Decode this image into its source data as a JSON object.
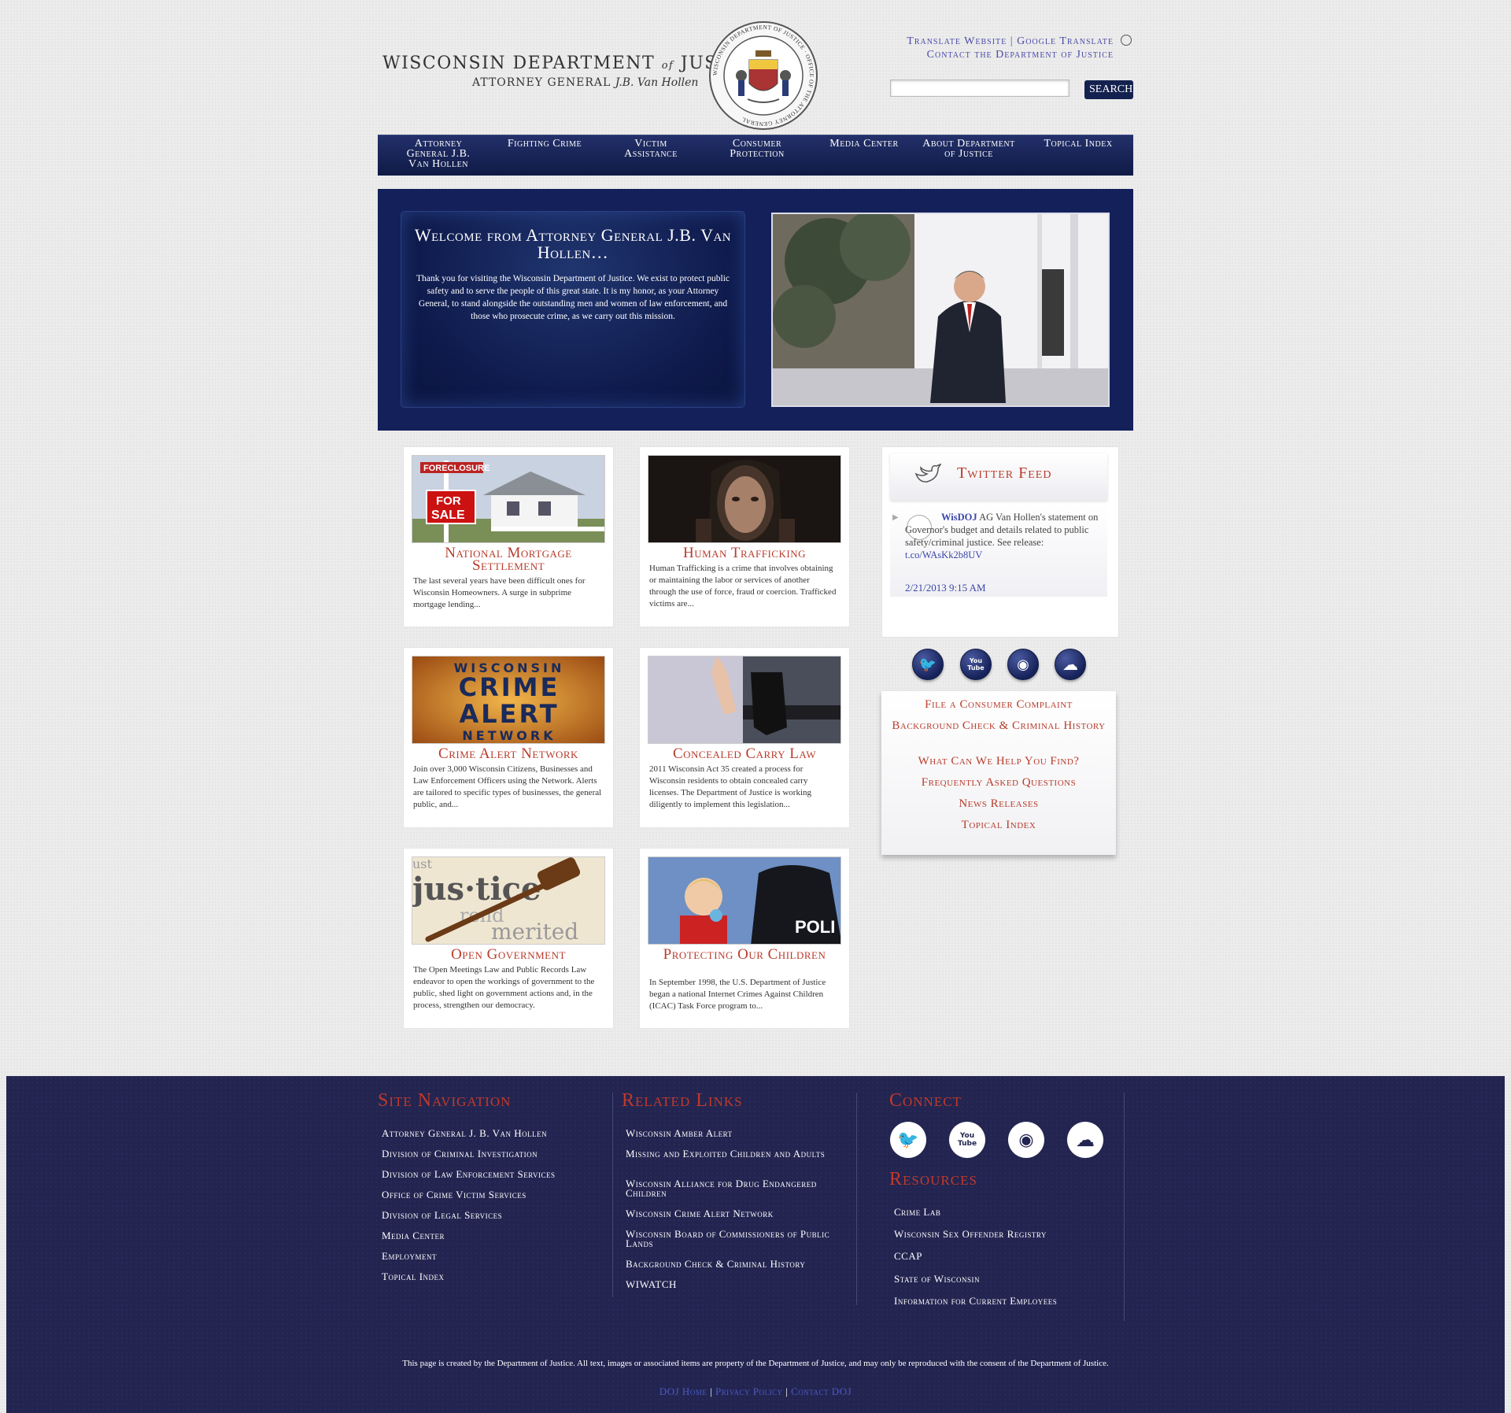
{
  "header": {
    "title_part1": "WISCONSIN DEPARTMENT",
    "title_of": "of",
    "title_part2": "JUSTICE",
    "subtitle_prefix": "ATTORNEY GENERAL",
    "subtitle_name": "J.B. Van Hollen",
    "seal_text": "WISCONSIN DEPARTMENT OF JUSTICE · OFFICE OF THE ATTORNEY GENERAL",
    "translate_website": "Translate Website",
    "link_separator": "|",
    "google_translate": "Google Translate",
    "contact": "Contact the Department of Justice",
    "search_placeholder": "",
    "search_button": "SEARCH"
  },
  "nav": [
    {
      "label": "Attorney General J.B. Van Hollen"
    },
    {
      "label": "Fighting Crime"
    },
    {
      "label": "Victim Assistance"
    },
    {
      "label": "Consumer Protection"
    },
    {
      "label": "Media Center"
    },
    {
      "label": "About Department of Justice"
    },
    {
      "label": "Topical Index"
    }
  ],
  "hero": {
    "title": "Welcome from Attorney General J.B. Van Hollen…",
    "text": "Thank you for visiting the Wisconsin Department of Justice. We exist to protect public safety and to serve the people of this great state. It is my honor, as your Attorney General, to stand alongside the outstanding men and women of law enforcement, and those who prosecute crime, as we carry out this mission."
  },
  "cards": [
    {
      "title": "National Mortgage Settlement",
      "text": "The last several years have been difficult ones for Wisconsin Homeowners. A surge in subprime mortgage lending...",
      "img_sign1": "FORECLOSURE",
      "img_sign2": "FOR",
      "img_sign3": "SALE"
    },
    {
      "title": "Human Trafficking",
      "text": "Human Trafficking is a crime that involves obtaining or maintaining the labor or services of another through the use of force, fraud or coercion. Trafficked victims are..."
    },
    {
      "title": "Crime Alert Network",
      "text": "Join over 3,000 Wisconsin Citizens, Businesses and Law Enforcement Officers using the Network. Alerts are tailored to specific types of businesses, the general public, and...",
      "img_line1": "WISCONSIN",
      "img_line2": "CRIME",
      "img_line3": "ALERT",
      "img_line4": "NETWORK"
    },
    {
      "title": "Concealed Carry Law",
      "text": "2011 Wisconsin Act 35 created a process for Wisconsin residents to obtain concealed carry licenses. The Department of Justice is working diligently to implement this legislation..."
    },
    {
      "title": "Open Government",
      "text": "The Open Meetings Law and Public Records Law endeavor to open the workings of government to the public, shed light on government actions and, in the process, strengthen our democracy.",
      "img_word1": "jus·tice",
      "img_word2": "rend",
      "img_word3": "merited"
    },
    {
      "title": "Protecting Our Children",
      "text": "In September 1998, the U.S. Department of Justice began a national Internet Crimes Against Children (ICAC) Task Force program to...",
      "img_word": "POLI"
    }
  ],
  "twitter": {
    "title": "Twitter Feed",
    "user": "WisDOJ",
    "text": "AG Van Hollen's statement on Governor's budget and details related to public safety/criminal justice. See release:",
    "link": "t.co/WAsKk2b8UV",
    "time": "2/21/2013 9:15 AM"
  },
  "social_icons": [
    {
      "name": "twitter-icon",
      "glyph": "🐦"
    },
    {
      "name": "youtube-icon",
      "glyph": "You Tube"
    },
    {
      "name": "rss-icon",
      "glyph": "◉"
    },
    {
      "name": "soundcloud-icon",
      "glyph": "☁"
    }
  ],
  "quick_links": [
    "File a Consumer Complaint",
    "Background Check & Criminal History",
    "What Can We Help You Find?",
    "Frequently Asked Questions",
    "News Releases",
    "Topical Index"
  ],
  "footer": {
    "site_nav_heading": "Site Navigation",
    "site_nav": [
      "Attorney General J. B. Van Hollen",
      "Division of Criminal Investigation",
      "Division of Law Enforcement Services",
      "Office of Crime Victim Services",
      "Division of Legal Services",
      "Media Center",
      "Employment",
      "Topical Index"
    ],
    "related_heading": "Related Links",
    "related": [
      "Wisconsin Amber Alert",
      "Missing and Exploited Children and Adults",
      "Wisconsin Alliance for Drug Endangered Children",
      "Wisconsin Crime Alert Network",
      "Wisconsin Board of Commissioners of Public Lands",
      "Background Check & Criminal History",
      "WIWATCH"
    ],
    "connect_heading": "Connect",
    "resources_heading": "Resources",
    "resources": [
      "Crime Lab",
      "Wisconsin Sex Offender Registry",
      "CCAP",
      "State of Wisconsin",
      "Information for Current Employees"
    ],
    "copyright": "This page is created by the Department of Justice. All text, images or associated items are property of the Department of Justice, and may only be reproduced with the consent of the Department of Justice.",
    "bottom_links": [
      "DOJ Home",
      "Privacy Policy",
      "Contact DOJ"
    ],
    "bottom_separator": "|"
  },
  "colors": {
    "navy": "#13205a",
    "accent_red": "#b83c2c",
    "link_blue": "#4a4aa8",
    "footer_bg": "#232550"
  }
}
